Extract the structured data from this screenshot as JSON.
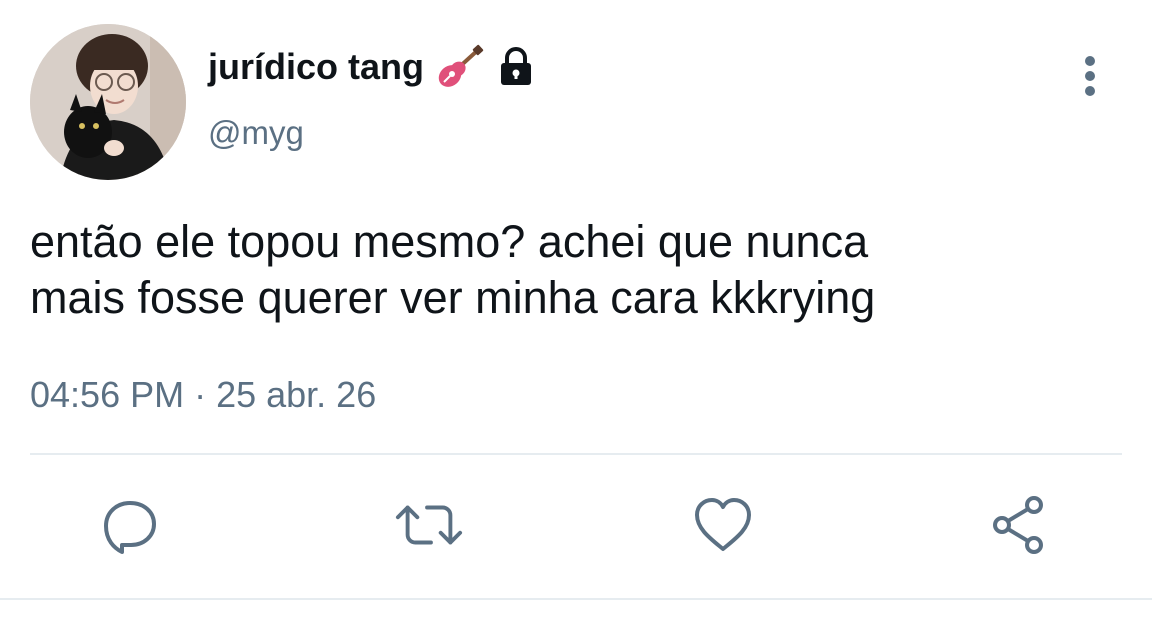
{
  "tweet": {
    "author": {
      "display_name": "jurídico tang",
      "handle": "@myg",
      "name_icons": [
        "guitar-icon",
        "lock-icon"
      ]
    },
    "text_lines": [
      "então ele topou mesmo? achei que nunca",
      "mais fosse querer ver minha cara kkkrying"
    ],
    "timestamp": "04:56 PM · 25 abr. 26",
    "actions": [
      "reply-icon",
      "retweet-icon",
      "like-icon",
      "share-icon"
    ]
  },
  "colors": {
    "text_primary": "#0f1419",
    "text_secondary": "#5b7083",
    "divider": "#e6ecf0"
  }
}
